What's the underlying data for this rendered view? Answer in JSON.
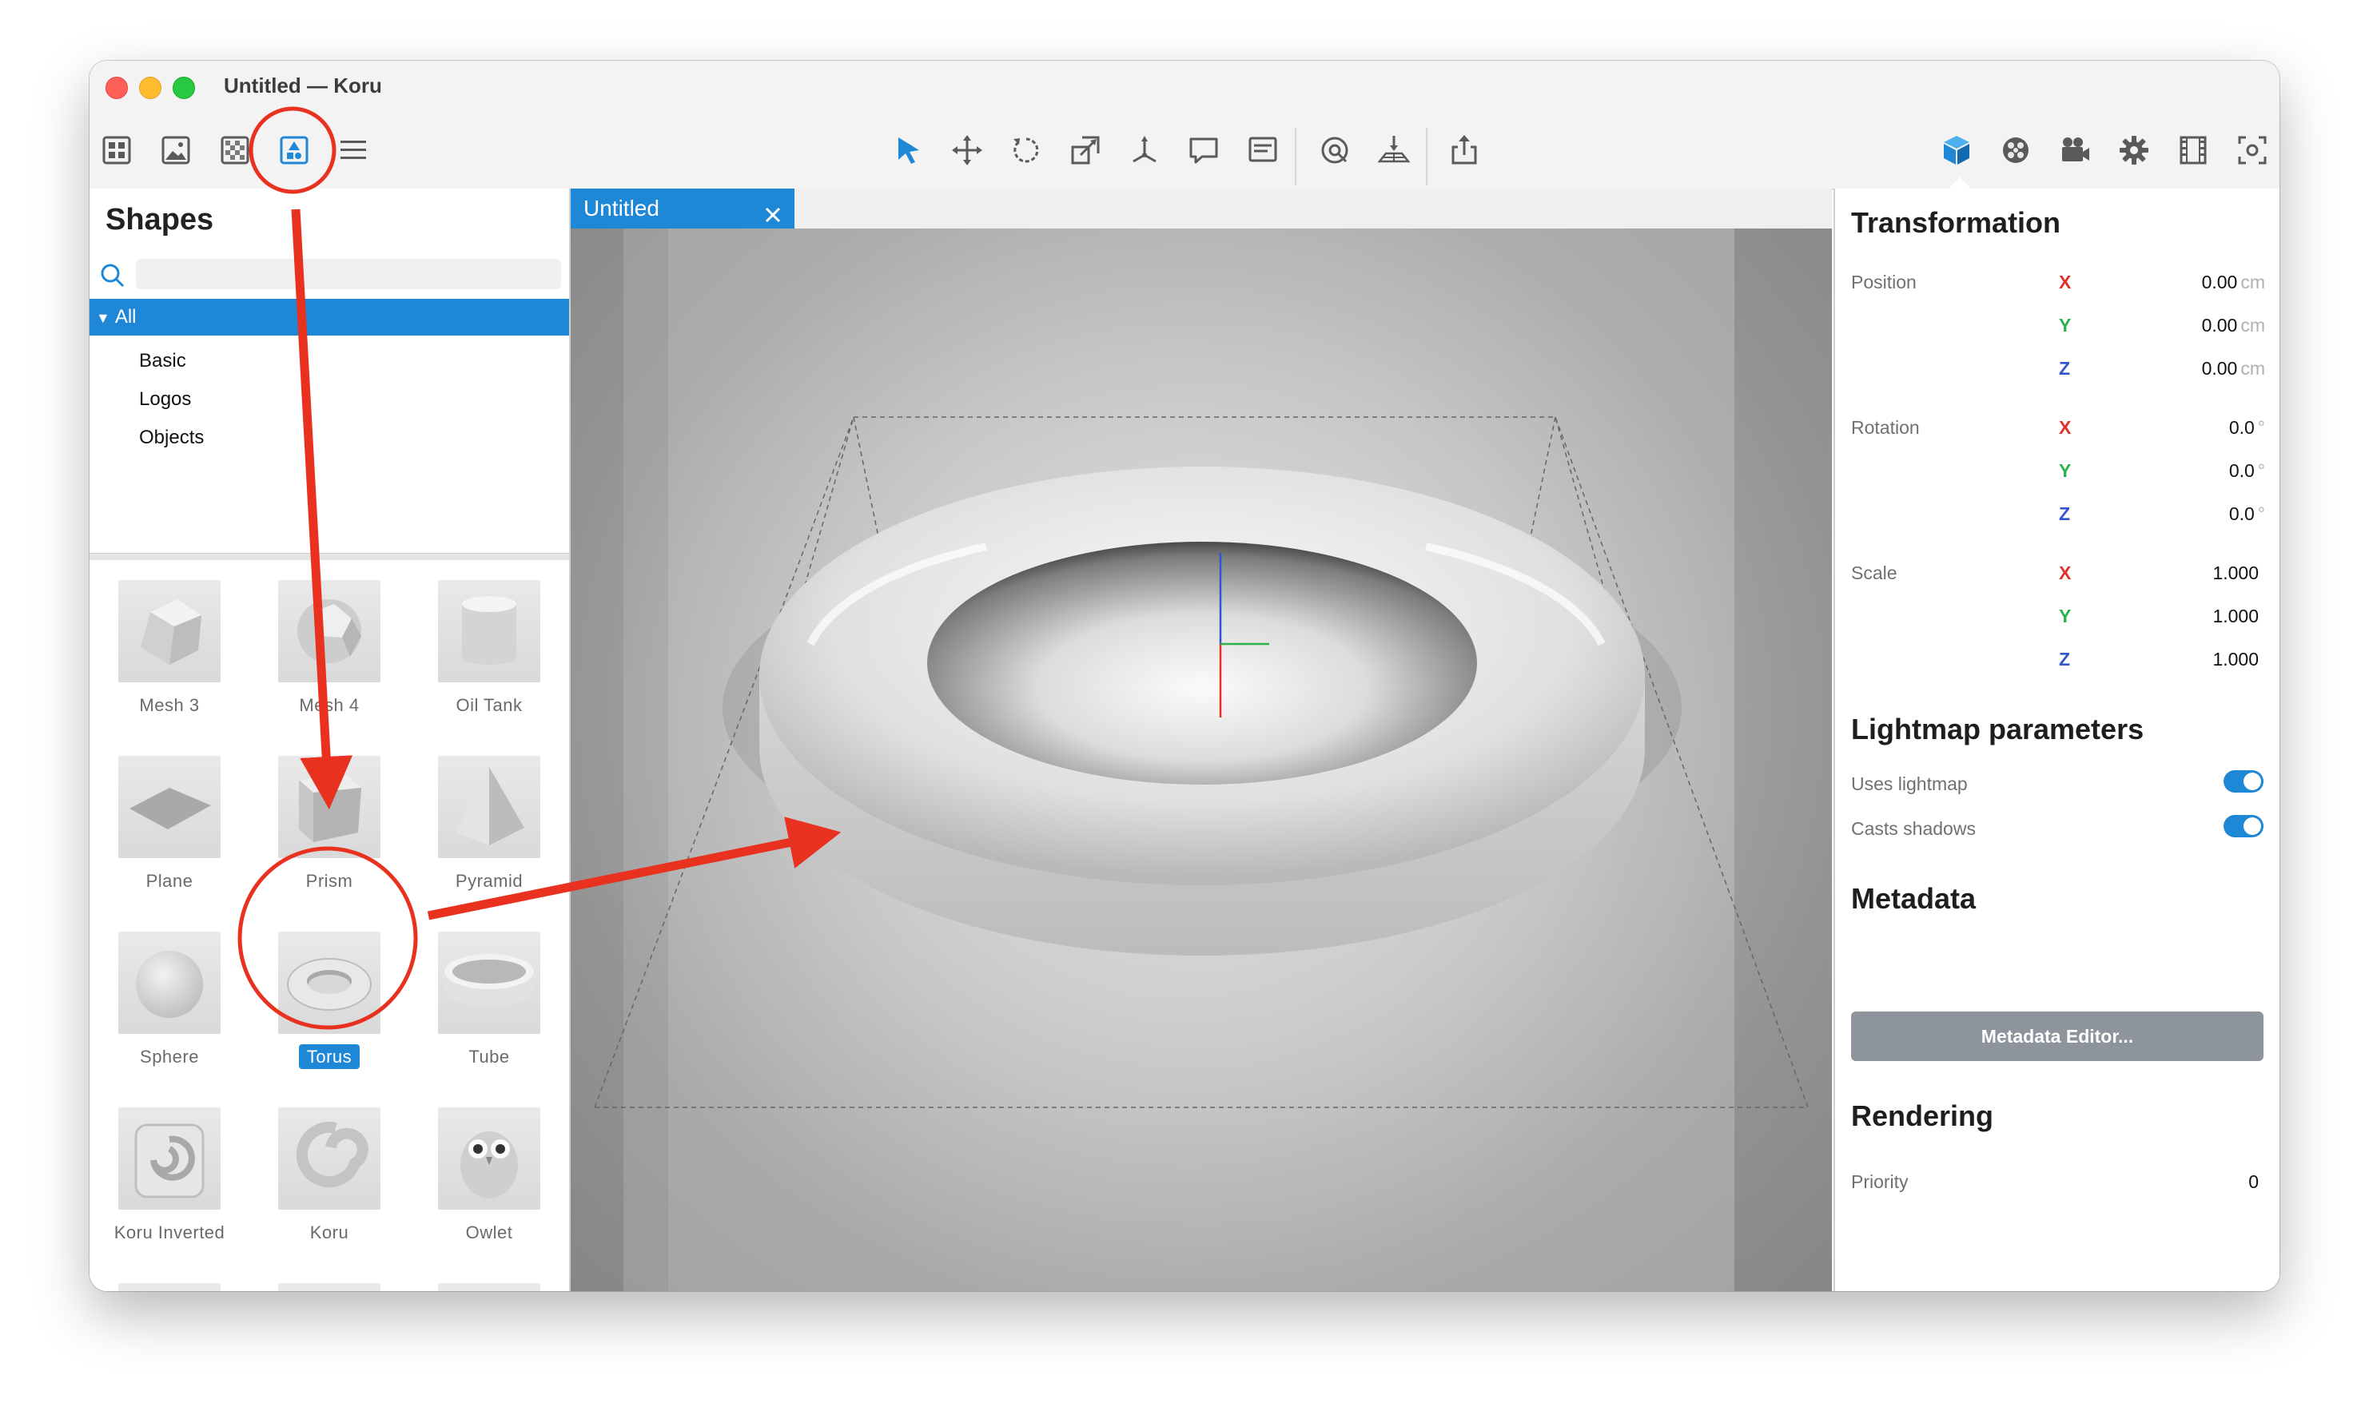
{
  "window": {
    "title": "Untitled — Koru"
  },
  "toolbar": {
    "left": [
      {
        "icon": "grid-view-icon"
      },
      {
        "icon": "image-icon"
      },
      {
        "icon": "texture-icon"
      },
      {
        "icon": "shapes-icon",
        "active": true
      },
      {
        "icon": "list-icon"
      }
    ],
    "center": [
      {
        "icon": "select-arrow-icon",
        "active": true
      },
      {
        "icon": "move-icon"
      },
      {
        "icon": "rotate-icon"
      },
      {
        "icon": "scale-icon"
      },
      {
        "icon": "axes-icon"
      },
      {
        "icon": "comment-icon"
      },
      {
        "icon": "note-icon"
      },
      {
        "icon": "camera-target-icon"
      },
      {
        "icon": "floor-grid-icon"
      },
      {
        "icon": "share-icon"
      }
    ],
    "right": [
      {
        "icon": "object-cube-icon",
        "active": true
      },
      {
        "icon": "material-icon"
      },
      {
        "icon": "camera-icon"
      },
      {
        "icon": "settings-gear-icon"
      },
      {
        "icon": "film-icon"
      },
      {
        "icon": "focus-icon"
      }
    ]
  },
  "sidebar": {
    "title": "Shapes",
    "search_placeholder": "",
    "categories": {
      "selected": "All",
      "items": [
        "Basic",
        "Logos",
        "Objects"
      ]
    },
    "shapes": [
      {
        "label": "Mesh 3",
        "thumb": "mesh3"
      },
      {
        "label": "Mesh 4",
        "thumb": "mesh4"
      },
      {
        "label": "Oil Tank",
        "thumb": "oiltank"
      },
      {
        "label": "Plane",
        "thumb": "plane"
      },
      {
        "label": "Prism",
        "thumb": "prism"
      },
      {
        "label": "Pyramid",
        "thumb": "pyramid"
      },
      {
        "label": "Sphere",
        "thumb": "sphere"
      },
      {
        "label": "Torus",
        "thumb": "torus",
        "selected": true
      },
      {
        "label": "Tube",
        "thumb": "tube"
      },
      {
        "label": "Koru Inverted",
        "thumb": "koru-inverted"
      },
      {
        "label": "Koru",
        "thumb": "koru"
      },
      {
        "label": "Owlet",
        "thumb": "owlet"
      },
      {
        "label": "",
        "thumb": "orange-logo"
      },
      {
        "label": "",
        "thumb": "soccer-ball"
      },
      {
        "label": "",
        "thumb": "soda-can"
      }
    ]
  },
  "viewport": {
    "tab_label": "Untitled"
  },
  "inspector": {
    "transformation": {
      "title": "Transformation",
      "position": {
        "label": "Position",
        "x": "0.00",
        "y": "0.00",
        "z": "0.00",
        "unit": "cm"
      },
      "rotation": {
        "label": "Rotation",
        "x": "0.0",
        "y": "0.0",
        "z": "0.0",
        "unit": "°"
      },
      "scale": {
        "label": "Scale",
        "x": "1.000",
        "y": "1.000",
        "z": "1.000"
      }
    },
    "axis_labels": {
      "x": "X",
      "y": "Y",
      "z": "Z"
    },
    "lightmap": {
      "title": "Lightmap parameters",
      "uses_lightmap": "Uses lightmap",
      "uses_lightmap_on": true,
      "casts_shadows": "Casts shadows",
      "casts_shadows_on": true
    },
    "metadata": {
      "title": "Metadata",
      "button": "Metadata Editor..."
    },
    "rendering": {
      "title": "Rendering",
      "priority_label": "Priority",
      "priority_value": "0"
    }
  },
  "colors": {
    "accent": "#1e88d6",
    "annotation_red": "#e8321f",
    "axis_x": "#e0312b",
    "axis_y": "#2bb24c",
    "axis_z": "#3355cc"
  }
}
